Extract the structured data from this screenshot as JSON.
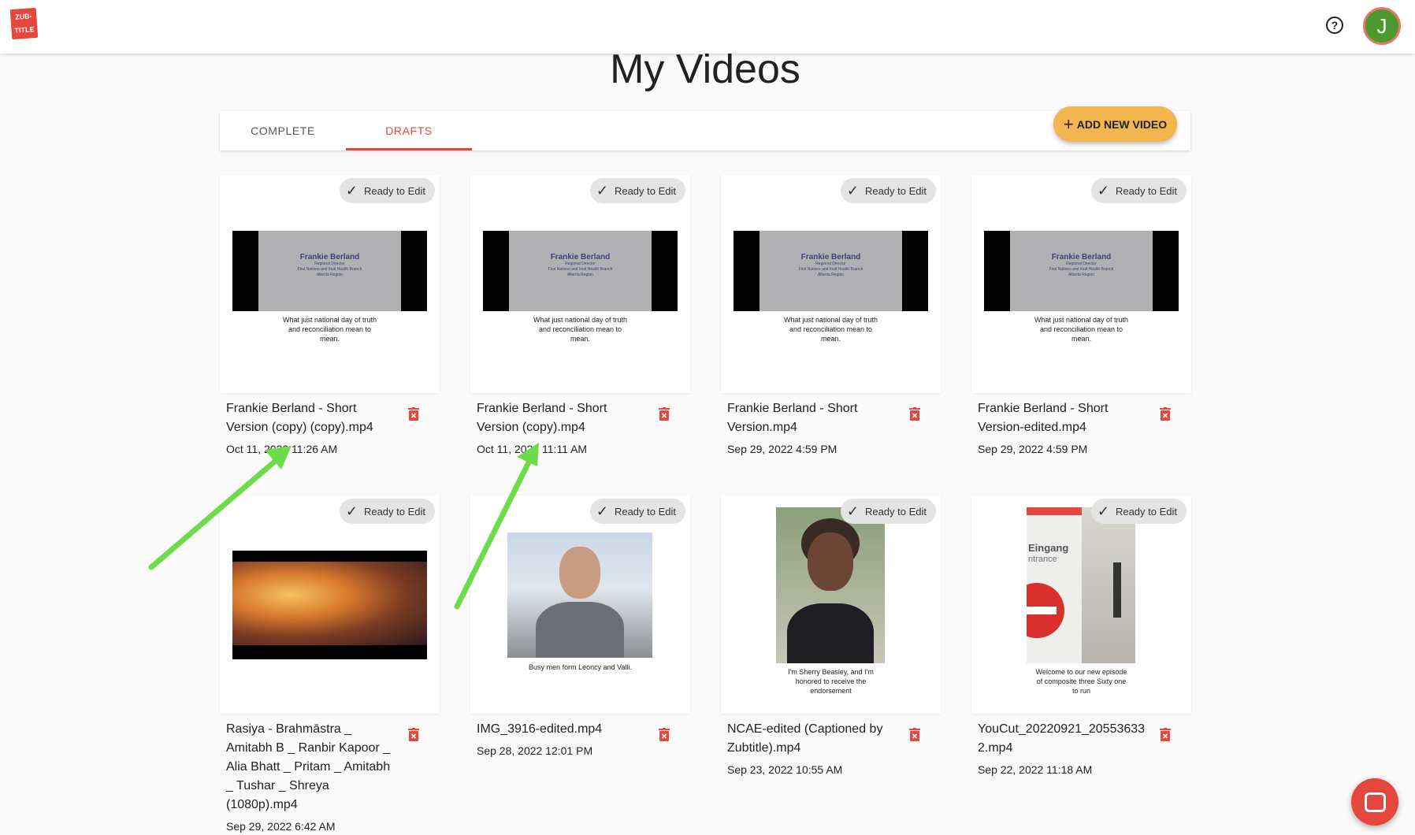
{
  "header": {
    "logo_line1": "ZUB-",
    "logo_line2": "TITLE",
    "help_icon": "?",
    "avatar_initial": "J"
  },
  "page": {
    "title": "My Videos"
  },
  "tabs": [
    {
      "label": "COMPLETE",
      "active": false
    },
    {
      "label": "DRAFTS",
      "active": true
    }
  ],
  "add_button": {
    "icon": "+",
    "label": "ADD NEW VIDEO"
  },
  "status_label": "Ready to Edit",
  "slide": {
    "name": "Frankie Berland",
    "line1": "Regional Director",
    "line2": "First Nations and Inuit Health Branch",
    "line3": "Alberta Region"
  },
  "videos": [
    {
      "title": "Frankie Berland - Short Version (copy) (copy).mp4",
      "date": "Oct 11, 2022 11:26 AM",
      "caption": "What just national day of truth and reconciliation mean to mean."
    },
    {
      "title": "Frankie Berland - Short Version (copy).mp4",
      "date": "Oct 11, 2022 11:11 AM",
      "caption": "What just national day of truth and reconciliation mean to mean."
    },
    {
      "title": "Frankie Berland - Short Version.mp4",
      "date": "Sep 29, 2022 4:59 PM",
      "caption": "What just national day of truth and reconciliation mean to mean."
    },
    {
      "title": "Frankie Berland - Short Version-edited.mp4",
      "date": "Sep 29, 2022 4:59 PM",
      "caption": "What just national day of truth and reconciliation mean to mean."
    },
    {
      "title": "Rasiya - Brahmāstra _ Amitabh B _ Ranbir Kapoor _ Alia Bhatt _ Pritam _ Amitabh _ Tushar _ Shreya (1080p).mp4",
      "date": "Sep 29, 2022 6:42 AM",
      "caption": ""
    },
    {
      "title": "IMG_3916-edited.mp4",
      "date": "Sep 28, 2022 12:01 PM",
      "caption": "Busy men form Leoncy and Valli."
    },
    {
      "title": "NCAE-edited (Captioned by Zubtitle).mp4",
      "date": "Sep 23, 2022 10:55 AM",
      "caption": "I'm Sherry Beasley, and I'm honored to receive the endorsement"
    },
    {
      "title": "YouCut_20220921_205536332.mp4",
      "date": "Sep 22, 2022 11:18 AM",
      "caption": "Welcome to our new episode of composite three Sixty one to run"
    }
  ],
  "video7_sign": {
    "line1": "Eingang",
    "line2": "ntrance"
  },
  "colors": {
    "accent": "#e5473d",
    "add_button": "#f3b64f",
    "arrow": "#6ddc4b",
    "avatar": "#4c9a2f"
  }
}
